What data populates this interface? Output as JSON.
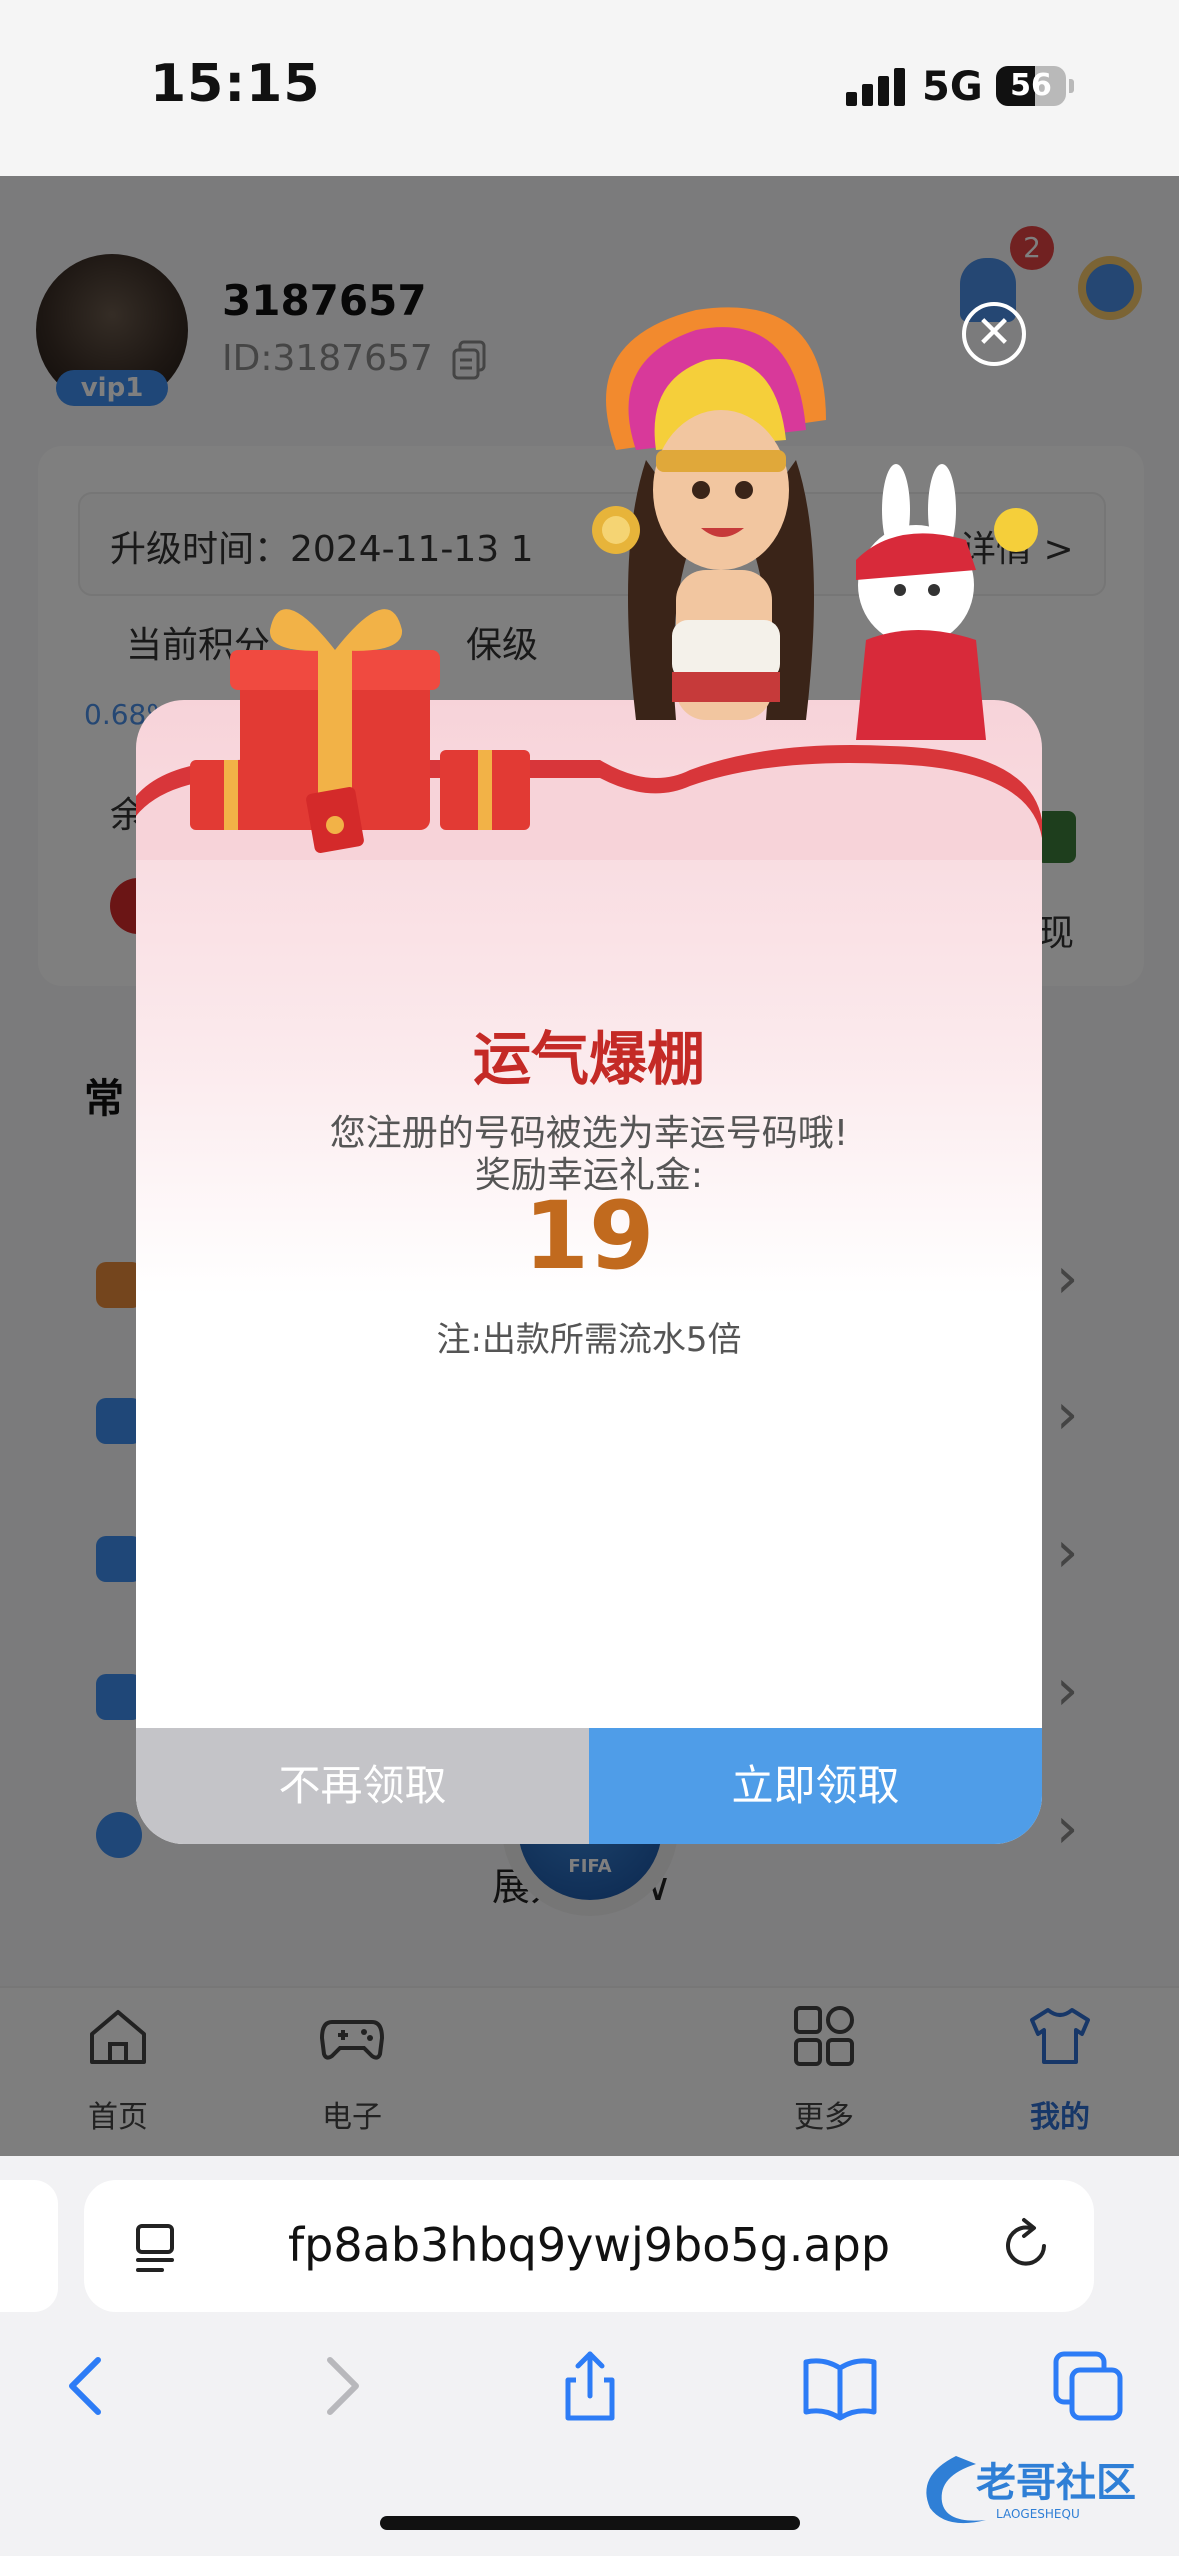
{
  "status_bar": {
    "time": "15:15",
    "network": "5G",
    "battery": "56",
    "battery_level": 0.56
  },
  "profile": {
    "username": "3187657",
    "user_id": "ID:3187657",
    "vip": "vip1",
    "notification_count": "2"
  },
  "info_card": {
    "upgrade_time": "升级时间：2024-11-13 1",
    "detail_link": "详情 >",
    "current_points": "当前积分",
    "keep_level": "保级",
    "percent": "0.68%",
    "balance_stub": "余",
    "withdraw_stub": "现"
  },
  "common": {
    "title": "常",
    "expand_more": "展开更多∨"
  },
  "tabbar": {
    "tabs": [
      {
        "label": "首页",
        "icon": "home-icon"
      },
      {
        "label": "电子",
        "icon": "gamepad-icon"
      },
      {
        "label": "更多",
        "icon": "grid-icon"
      },
      {
        "label": "我的",
        "icon": "shirt-icon"
      }
    ],
    "center_logo": "FIFA"
  },
  "modal": {
    "title": "运气爆棚",
    "message": "您注册的号码被选为幸运号码哦!",
    "reward_label": "奖励幸运礼金:",
    "amount": "19",
    "note": "注:出款所需流水5倍",
    "decline_button": "不再领取",
    "claim_button": "立即领取",
    "close_icon": "close-icon"
  },
  "browser": {
    "url": "fp8ab3hbq9ywj9bo5g.app",
    "icons": [
      "back-icon",
      "forward-icon",
      "share-icon",
      "bookmarks-icon",
      "tabs-icon"
    ]
  },
  "watermark": {
    "text": "老哥社区",
    "subtext": "LAOGESHEQU"
  },
  "colors": {
    "accent_blue": "#4f9de8",
    "title_red": "#c42a26",
    "amount_orange": "#c16a1e",
    "decline_gray": "#c4c4c8"
  }
}
